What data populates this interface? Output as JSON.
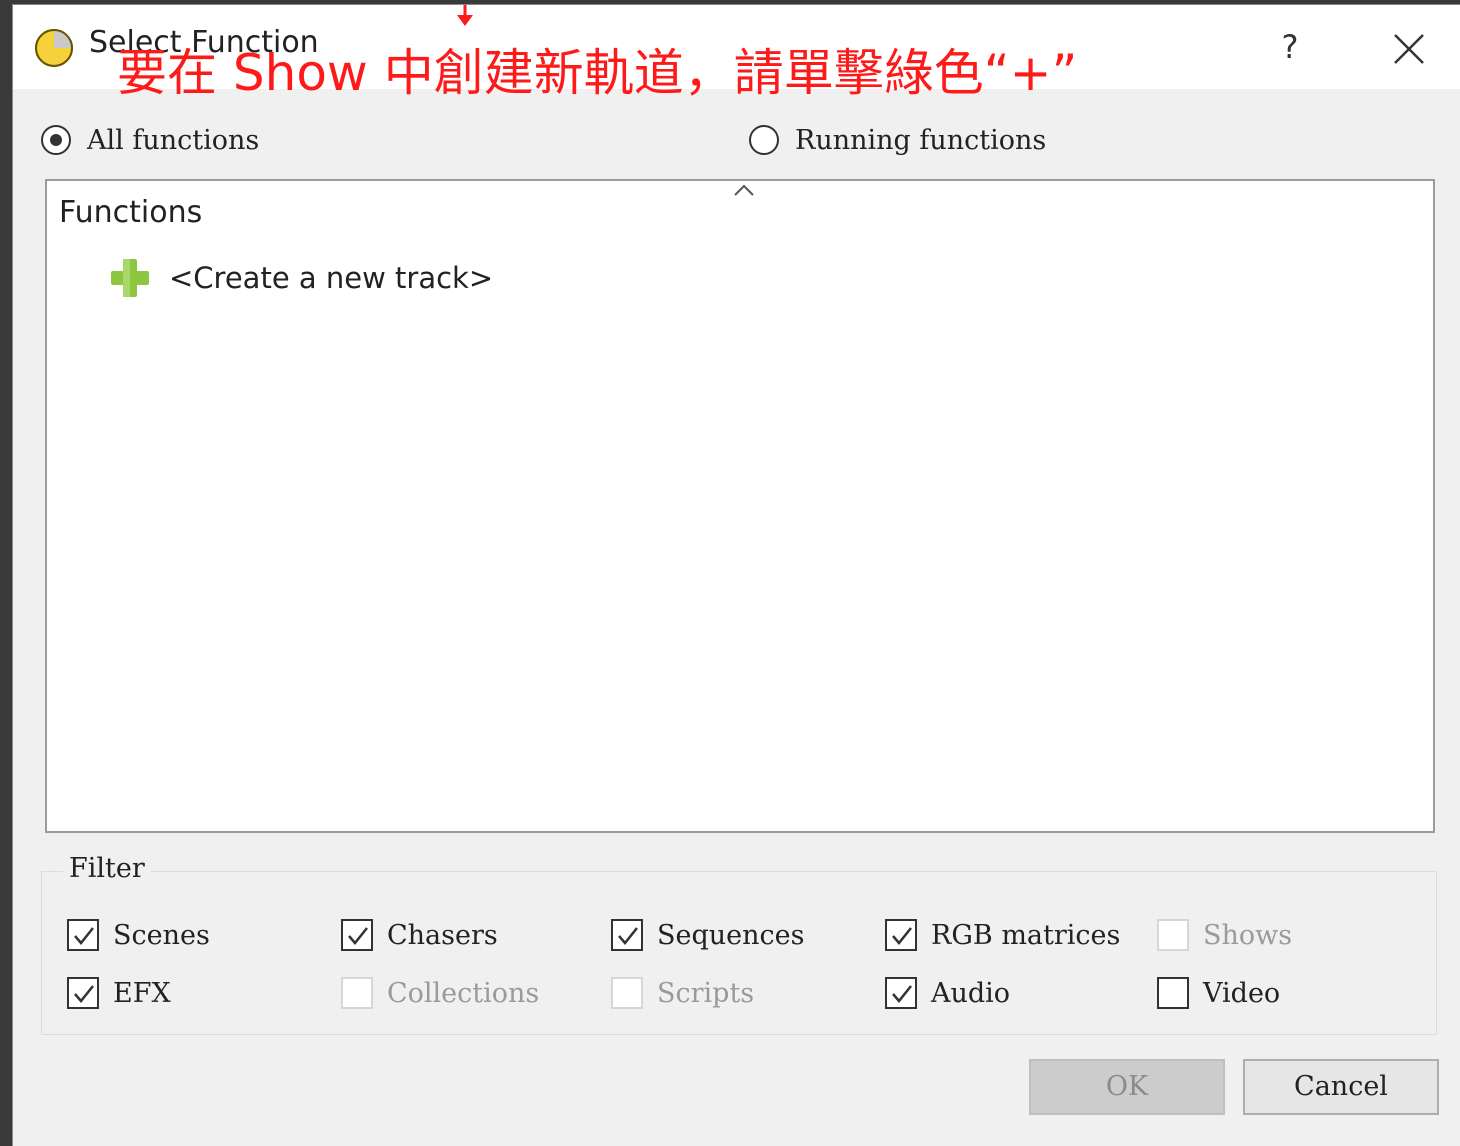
{
  "window": {
    "title": "Select Function",
    "help_label": "?",
    "close_icon": "close-icon",
    "app_icon": "app-logo-icon"
  },
  "annotation": {
    "text": "要在 Show 中創建新軌道，請單擊綠色“+”",
    "color": "#ff1a1a"
  },
  "mode": {
    "all_label": "All functions",
    "all_selected": true,
    "running_label": "Running functions",
    "running_selected": false
  },
  "tree": {
    "header": "Functions",
    "items": [
      {
        "label": "<Create a new track>",
        "icon": "green-plus-icon"
      }
    ]
  },
  "filter": {
    "title": "Filter",
    "options": [
      {
        "label": "Scenes",
        "checked": true,
        "enabled": true
      },
      {
        "label": "Chasers",
        "checked": true,
        "enabled": true
      },
      {
        "label": "Sequences",
        "checked": true,
        "enabled": true
      },
      {
        "label": "RGB matrices",
        "checked": true,
        "enabled": true
      },
      {
        "label": "Shows",
        "checked": false,
        "enabled": false
      },
      {
        "label": "EFX",
        "checked": true,
        "enabled": true
      },
      {
        "label": "Collections",
        "checked": false,
        "enabled": false
      },
      {
        "label": "Scripts",
        "checked": false,
        "enabled": false
      },
      {
        "label": "Audio",
        "checked": true,
        "enabled": true
      },
      {
        "label": "Video",
        "checked": false,
        "enabled": true
      }
    ]
  },
  "buttons": {
    "ok_label": "OK",
    "ok_enabled": false,
    "cancel_label": "Cancel"
  },
  "colors": {
    "accent_green": "#8dc63f",
    "annotation_red": "#ff1a1a"
  }
}
